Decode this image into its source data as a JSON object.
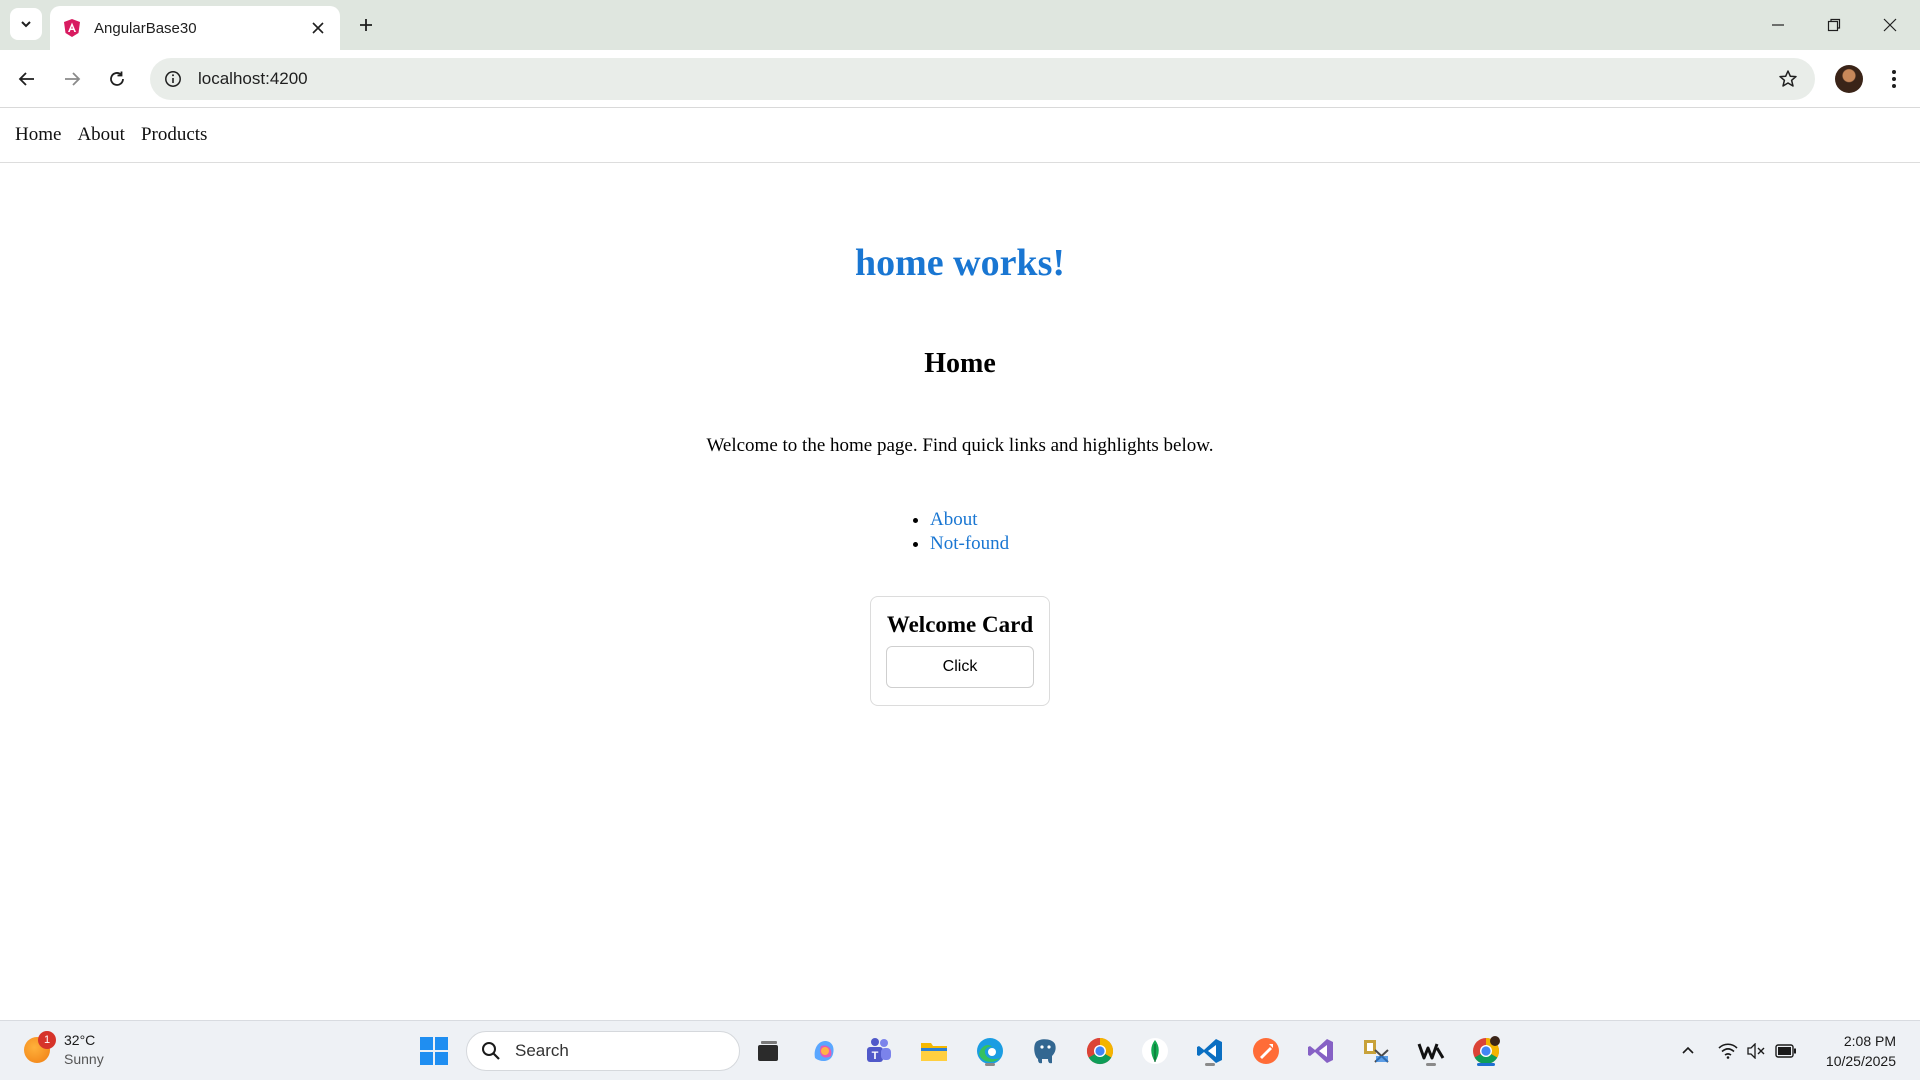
{
  "browser": {
    "tab_title": "AngularBase30",
    "url": "localhost:4200",
    "colors": {
      "tabstrip": "#dfe6df",
      "omnibox": "#e9ede9"
    }
  },
  "site": {
    "nav": [
      "Home",
      "About",
      "Products"
    ],
    "headline": "home works!",
    "page_title": "Home",
    "intro": "Welcome to the home page. Find quick links and highlights below.",
    "quick_links": [
      "About",
      "Not-found"
    ],
    "card": {
      "title": "Welcome Card",
      "button_label": "Click"
    },
    "colors": {
      "accent": "#1976d2"
    }
  },
  "taskbar": {
    "weather": {
      "temp": "32°C",
      "condition": "Sunny",
      "badge_count": "1"
    },
    "search_label": "Search",
    "pinned_icons": [
      "task-view-icon",
      "copilot-icon",
      "teams-icon",
      "file-explorer-icon",
      "edge-icon",
      "postgresql-icon",
      "chrome-icon",
      "mongodb-compass-icon",
      "vscode-icon",
      "postman-icon",
      "visual-studio-icon",
      "app-icon",
      "app-w-icon",
      "chrome-profile-icon"
    ],
    "clock": {
      "time": "2:08 PM",
      "date": "10/25/2025"
    }
  }
}
